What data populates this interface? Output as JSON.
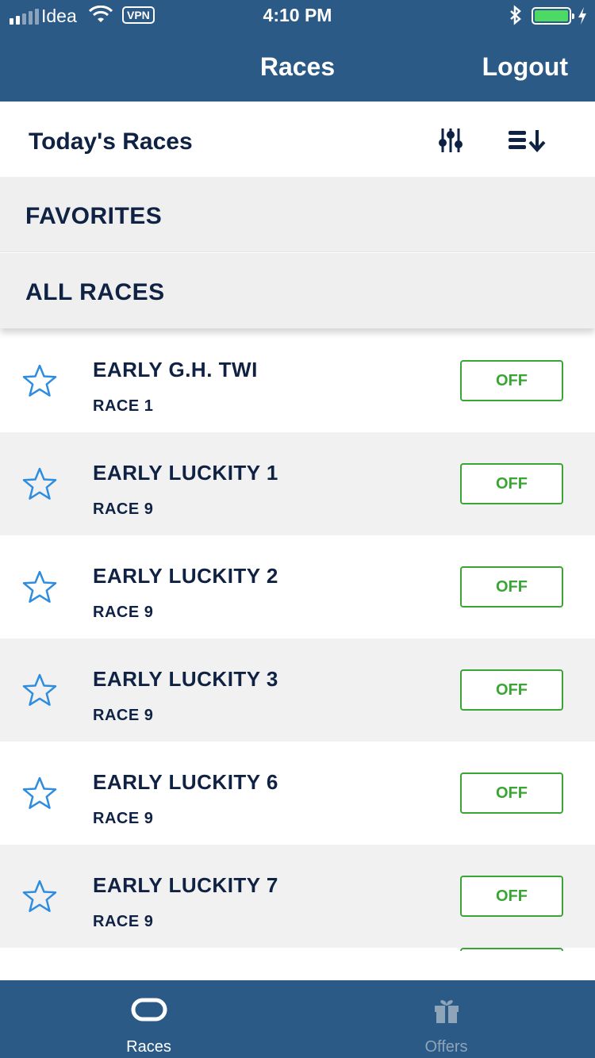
{
  "status_bar": {
    "carrier": "Idea",
    "vpn": "VPN",
    "time": "4:10 PM"
  },
  "nav": {
    "title": "Races",
    "logout_label": "Logout"
  },
  "subheader": {
    "title": "Today's Races",
    "filter_icon": "sliders-icon",
    "sort_icon": "sort-icon"
  },
  "sections": {
    "favorites": "FAVORITES",
    "all_races": "ALL RACES"
  },
  "races": [
    {
      "name": "EARLY G.H. TWI",
      "race": "RACE 1",
      "status": "OFF"
    },
    {
      "name": "EARLY LUCKITY 1",
      "race": "RACE 9",
      "status": "OFF"
    },
    {
      "name": "EARLY LUCKITY 2",
      "race": "RACE 9",
      "status": "OFF"
    },
    {
      "name": "EARLY LUCKITY 3",
      "race": "RACE 9",
      "status": "OFF"
    },
    {
      "name": "EARLY LUCKITY 6",
      "race": "RACE 9",
      "status": "OFF"
    },
    {
      "name": "EARLY LUCKITY 7",
      "race": "RACE 9",
      "status": "OFF"
    }
  ],
  "tabs": [
    {
      "label": "Races",
      "icon": "track-icon",
      "active": true
    },
    {
      "label": "Offers",
      "icon": "gift-icon",
      "active": false
    }
  ],
  "colors": {
    "header": "#2c5a86",
    "text_dark": "#0f2244",
    "accent_green": "#3aa534",
    "star_blue": "#2f8de0"
  }
}
